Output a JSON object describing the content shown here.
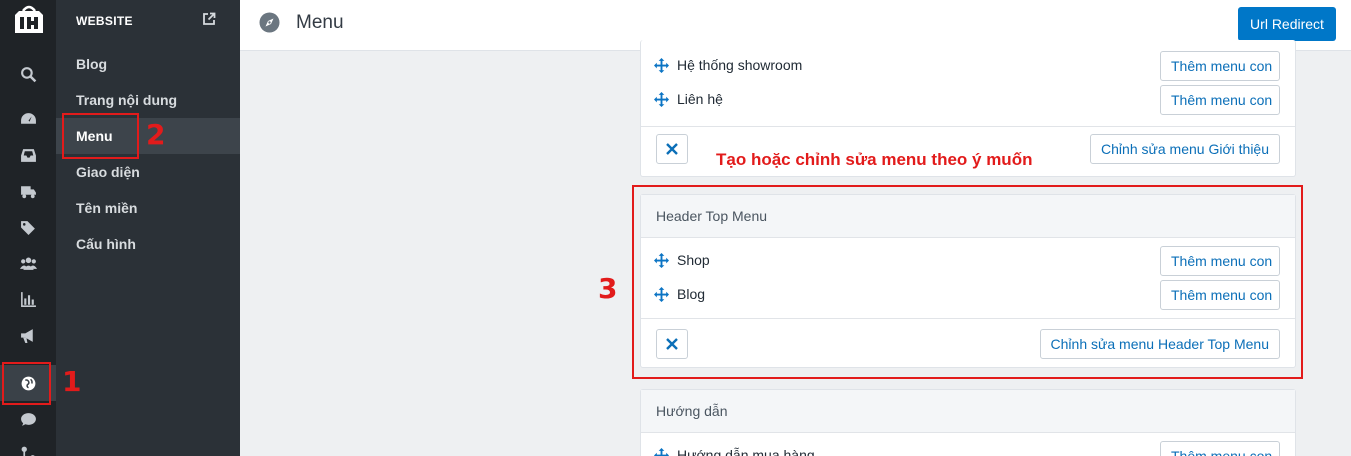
{
  "rail": {
    "icons": [
      "search-icon",
      "dashboard-icon",
      "inbox-icon",
      "truck-icon",
      "tags-icon",
      "users-icon",
      "bar-chart-icon",
      "megaphone-icon",
      "globe-icon",
      "chat-icon",
      "integrations-icon"
    ],
    "active": "globe-icon"
  },
  "sidebar": {
    "heading": "WEBSITE",
    "items": [
      {
        "label": "Blog"
      },
      {
        "label": "Trang nội dung"
      },
      {
        "label": "Menu"
      },
      {
        "label": "Giao diện"
      },
      {
        "label": "Tên miền"
      },
      {
        "label": "Cấu hình"
      }
    ],
    "active_label": "Menu"
  },
  "header": {
    "title": "Menu",
    "redirect_button": "Url Redirect"
  },
  "cards": {
    "intro": {
      "items": [
        {
          "label": "Hệ thống showroom",
          "action": "Thêm menu con"
        },
        {
          "label": "Liên hệ",
          "action": "Thêm menu con"
        }
      ],
      "edit_button": "Chỉnh sửa menu Giới thiệu"
    },
    "header_top": {
      "title": "Header Top Menu",
      "items": [
        {
          "label": "Shop",
          "action": "Thêm menu con"
        },
        {
          "label": "Blog",
          "action": "Thêm menu con"
        }
      ],
      "edit_button": "Chỉnh sửa menu Header Top Menu"
    },
    "guide": {
      "title": "Hướng dẫn",
      "items": [
        {
          "label": "Hướng dẫn mua hàng",
          "action": "Thêm menu con"
        }
      ]
    }
  },
  "annotations": {
    "step1": "1",
    "step2": "2",
    "step3": "3",
    "note": "Tạo hoặc chỉnh sửa menu theo ý muốn",
    "color": "#e21b1b"
  },
  "colors": {
    "accent": "#0077c8",
    "rail_bg": "#1f2327",
    "sidebar_bg": "#2b3137"
  }
}
